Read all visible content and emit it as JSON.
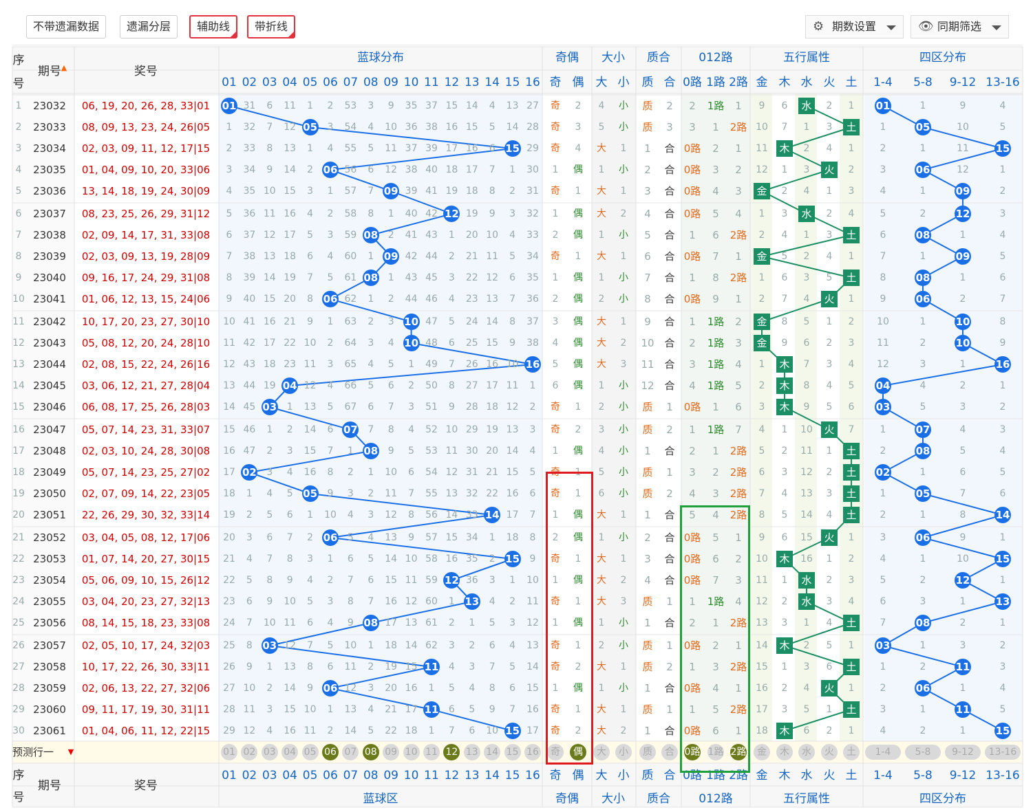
{
  "toolbar": {
    "buttons": [
      "不带遗漏数据",
      "遗漏分层",
      "辅助线",
      "带折线"
    ],
    "active": [
      false,
      false,
      true,
      true
    ],
    "period_setting": "期数设置",
    "same_filter": "同期筛选",
    "icons": [
      "gear-icon",
      "eye-icon"
    ]
  },
  "header": {
    "seq": "序号",
    "period": "期号",
    "draw": "奖号",
    "blue_dist": "蓝球分布",
    "odd_even": "奇偶",
    "big_small": "大小",
    "prime_comp": "质合",
    "route012": "012路",
    "five_elements": "五行属性",
    "four_zones": "四区分布",
    "blue_nums": [
      "01",
      "02",
      "03",
      "04",
      "05",
      "06",
      "07",
      "08",
      "09",
      "10",
      "11",
      "12",
      "13",
      "14",
      "15",
      "16"
    ],
    "oe": [
      "奇",
      "偶"
    ],
    "bs": [
      "大",
      "小"
    ],
    "pc": [
      "质",
      "合"
    ],
    "route": [
      "0路",
      "1路",
      "2路"
    ],
    "wx": [
      "金",
      "木",
      "水",
      "火",
      "土"
    ],
    "zones": [
      "1-4",
      "5-8",
      "9-12",
      "13-16"
    ]
  },
  "footer": {
    "seq": "序号",
    "period": "期号",
    "draw": "奖号",
    "blue_area": "蓝球区",
    "odd_even": "奇偶",
    "big_small": "大小",
    "prime_comp": "质合",
    "route012": "012路",
    "five_elements": "五行属性",
    "four_zones": "四区分布"
  },
  "predict": {
    "label": "预测行一",
    "hits": [
      "06",
      "08",
      "12"
    ],
    "hit_extra": [
      "偶",
      "0路",
      "2路"
    ]
  },
  "rows": [
    [
      "23032",
      "06, 19, 20, 26, 28, 33",
      "01",
      [
        0,
        31,
        6,
        11,
        1,
        2,
        53,
        3,
        9,
        35,
        37,
        15,
        14,
        4,
        13,
        27
      ],
      [
        "奇",
        "2"
      ],
      [
        "4",
        "小"
      ],
      [
        "质",
        "2"
      ],
      [
        "2",
        "1路",
        "1"
      ],
      [
        "9",
        "6",
        "水",
        "2",
        "1"
      ],
      [
        0,
        1,
        9,
        4
      ]
    ],
    [
      "23033",
      "08, 09, 13, 23, 24, 26",
      "05",
      [
        1,
        32,
        7,
        12,
        0,
        3,
        54,
        4,
        10,
        36,
        38,
        16,
        15,
        5,
        14,
        28
      ],
      [
        "奇",
        "3"
      ],
      [
        "5",
        "小"
      ],
      [
        "质",
        "3"
      ],
      [
        "3",
        "1",
        "2路"
      ],
      [
        "10",
        "7",
        "1",
        "3",
        "土"
      ],
      [
        1,
        0,
        10,
        5
      ]
    ],
    [
      "23034",
      "02, 03, 09, 11, 12, 17",
      "15",
      [
        2,
        33,
        8,
        13,
        1,
        4,
        55,
        5,
        11,
        37,
        39,
        17,
        16,
        6,
        0,
        29
      ],
      [
        "奇",
        "4"
      ],
      [
        "大",
        "1"
      ],
      [
        "1",
        "合"
      ],
      [
        "0路",
        "2",
        "1"
      ],
      [
        "11",
        "木",
        "2",
        "4",
        "1"
      ],
      [
        2,
        1,
        11,
        0
      ]
    ],
    [
      "23035",
      "01, 04, 09, 10, 20, 33",
      "06",
      [
        3,
        34,
        9,
        14,
        2,
        0,
        56,
        6,
        12,
        38,
        40,
        18,
        17,
        7,
        1,
        30
      ],
      [
        "1",
        "偶"
      ],
      [
        "1",
        "小"
      ],
      [
        "2",
        "合"
      ],
      [
        "0路",
        "3",
        "2"
      ],
      [
        "12",
        "1",
        "3",
        "火",
        "2"
      ],
      [
        3,
        0,
        12,
        1
      ]
    ],
    [
      "23036",
      "13, 14, 18, 19, 24, 30",
      "09",
      [
        4,
        35,
        10,
        15,
        3,
        1,
        57,
        7,
        0,
        39,
        41,
        19,
        18,
        8,
        2,
        31
      ],
      [
        "奇",
        "1"
      ],
      [
        "大",
        "1"
      ],
      [
        "3",
        "合"
      ],
      [
        "0路",
        "4",
        "3"
      ],
      [
        "金",
        "2",
        "4",
        "1",
        "3"
      ],
      [
        4,
        1,
        0,
        2
      ]
    ],
    [
      "23037",
      "08, 23, 25, 26, 29, 31",
      "12",
      [
        5,
        36,
        11,
        16,
        4,
        2,
        58,
        8,
        1,
        40,
        42,
        0,
        19,
        9,
        3,
        32
      ],
      [
        "1",
        "偶"
      ],
      [
        "大",
        "2"
      ],
      [
        "4",
        "合"
      ],
      [
        "0路",
        "5",
        "4"
      ],
      [
        "1",
        "3",
        "水",
        "2",
        "4"
      ],
      [
        5,
        2,
        0,
        3
      ]
    ],
    [
      "23038",
      "02, 09, 14, 17, 31, 33",
      "08",
      [
        6,
        37,
        12,
        17,
        5,
        3,
        59,
        0,
        2,
        41,
        43,
        1,
        20,
        10,
        4,
        33
      ],
      [
        "2",
        "偶"
      ],
      [
        "1",
        "小"
      ],
      [
        "5",
        "合"
      ],
      [
        "1",
        "6",
        "2路"
      ],
      [
        "2",
        "4",
        "1",
        "3",
        "土"
      ],
      [
        6,
        0,
        1,
        4
      ]
    ],
    [
      "23039",
      "02, 03, 09, 13, 19, 28",
      "09",
      [
        7,
        38,
        13,
        18,
        6,
        4,
        60,
        1,
        0,
        42,
        44,
        2,
        21,
        11,
        5,
        34
      ],
      [
        "奇",
        "1"
      ],
      [
        "大",
        "1"
      ],
      [
        "6",
        "合"
      ],
      [
        "0路",
        "7",
        "1"
      ],
      [
        "金",
        "5",
        "2",
        "4",
        "1"
      ],
      [
        7,
        1,
        0,
        5
      ]
    ],
    [
      "23040",
      "09, 16, 17, 24, 29, 31",
      "08",
      [
        8,
        39,
        14,
        19,
        7,
        5,
        61,
        0,
        1,
        43,
        45,
        3,
        22,
        12,
        6,
        35
      ],
      [
        "1",
        "偶"
      ],
      [
        "1",
        "小"
      ],
      [
        "7",
        "合"
      ],
      [
        "1",
        "8",
        "2路"
      ],
      [
        "1",
        "6",
        "3",
        "5",
        "土"
      ],
      [
        8,
        0,
        1,
        6
      ]
    ],
    [
      "23041",
      "01, 06, 12, 13, 15, 24",
      "06",
      [
        9,
        40,
        15,
        20,
        8,
        0,
        62,
        1,
        2,
        44,
        46,
        4,
        23,
        13,
        7,
        36
      ],
      [
        "2",
        "偶"
      ],
      [
        "2",
        "小"
      ],
      [
        "8",
        "合"
      ],
      [
        "0路",
        "9",
        "1"
      ],
      [
        "2",
        "7",
        "4",
        "火",
        "1"
      ],
      [
        9,
        0,
        2,
        7
      ]
    ],
    [
      "23042",
      "10, 17, 20, 23, 27, 30",
      "10",
      [
        10,
        41,
        16,
        21,
        9,
        1,
        63,
        2,
        3,
        0,
        47,
        5,
        24,
        14,
        8,
        37
      ],
      [
        "3",
        "偶"
      ],
      [
        "大",
        "1"
      ],
      [
        "9",
        "合"
      ],
      [
        "1",
        "1路",
        "2"
      ],
      [
        "金",
        "8",
        "5",
        "1",
        "2"
      ],
      [
        10,
        1,
        0,
        8
      ]
    ],
    [
      "23043",
      "05, 08, 12, 20, 24, 28",
      "10",
      [
        11,
        42,
        17,
        22,
        10,
        2,
        64,
        3,
        4,
        0,
        48,
        6,
        25,
        15,
        9,
        38
      ],
      [
        "4",
        "偶"
      ],
      [
        "大",
        "2"
      ],
      [
        "10",
        "合"
      ],
      [
        "2",
        "1路",
        "3"
      ],
      [
        "金",
        "9",
        "6",
        "2",
        "3"
      ],
      [
        11,
        2,
        0,
        9
      ]
    ],
    [
      "23044",
      "02, 08, 15, 22, 24, 26",
      "16",
      [
        12,
        43,
        18,
        23,
        11,
        3,
        65,
        4,
        5,
        1,
        49,
        7,
        26,
        16,
        10,
        0
      ],
      [
        "5",
        "偶"
      ],
      [
        "大",
        "3"
      ],
      [
        "11",
        "合"
      ],
      [
        "3",
        "1路",
        "4"
      ],
      [
        "1",
        "木",
        "7",
        "3",
        "4"
      ],
      [
        12,
        3,
        1,
        0
      ]
    ],
    [
      "23045",
      "03, 06, 12, 21, 27, 28",
      "04",
      [
        13,
        44,
        19,
        0,
        12,
        4,
        66,
        5,
        6,
        2,
        50,
        8,
        27,
        17,
        11,
        1
      ],
      [
        "6",
        "偶"
      ],
      [
        "1",
        "小"
      ],
      [
        "12",
        "合"
      ],
      [
        "4",
        "1路",
        "5"
      ],
      [
        "2",
        "木",
        "8",
        "4",
        "5"
      ],
      [
        0,
        4,
        2,
        1
      ]
    ],
    [
      "23046",
      "06, 08, 17, 25, 26, 28",
      "03",
      [
        14,
        45,
        0,
        1,
        13,
        5,
        67,
        6,
        7,
        3,
        51,
        9,
        28,
        18,
        12,
        2
      ],
      [
        "奇",
        "1"
      ],
      [
        "2",
        "小"
      ],
      [
        "质",
        "1"
      ],
      [
        "0路",
        "1",
        "6"
      ],
      [
        "3",
        "木",
        "9",
        "5",
        "6"
      ],
      [
        0,
        5,
        3,
        2
      ]
    ],
    [
      "23047",
      "05, 07, 14, 23, 31, 33",
      "07",
      [
        15,
        46,
        1,
        2,
        14,
        6,
        0,
        7,
        8,
        4,
        52,
        10,
        29,
        19,
        13,
        3
      ],
      [
        "奇",
        "2"
      ],
      [
        "3",
        "小"
      ],
      [
        "质",
        "2"
      ],
      [
        "1",
        "1路",
        "7"
      ],
      [
        "4",
        "1",
        "10",
        "火",
        "7"
      ],
      [
        1,
        0,
        4,
        3
      ]
    ],
    [
      "23048",
      "02, 03, 10, 24, 28, 30",
      "08",
      [
        16,
        47,
        2,
        3,
        15,
        7,
        1,
        0,
        9,
        5,
        53,
        11,
        30,
        20,
        14,
        4
      ],
      [
        "1",
        "偶"
      ],
      [
        "4",
        "小"
      ],
      [
        "1",
        "合"
      ],
      [
        "2",
        "1",
        "2路"
      ],
      [
        "5",
        "2",
        "11",
        "1",
        "土"
      ],
      [
        2,
        0,
        5,
        4
      ]
    ],
    [
      "23049",
      "05, 07, 14, 23, 25, 27",
      "02",
      [
        17,
        0,
        3,
        4,
        16,
        8,
        2,
        1,
        10,
        6,
        54,
        12,
        31,
        21,
        15,
        5
      ],
      [
        "奇",
        "1"
      ],
      [
        "5",
        "小"
      ],
      [
        "质",
        "1"
      ],
      [
        "3",
        "2",
        "2路"
      ],
      [
        "6",
        "3",
        "12",
        "2",
        "土"
      ],
      [
        0,
        1,
        6,
        5
      ]
    ],
    [
      "23050",
      "02, 07, 09, 14, 22, 23",
      "05",
      [
        18,
        1,
        4,
        5,
        0,
        9,
        3,
        2,
        11,
        7,
        55,
        13,
        32,
        22,
        16,
        6
      ],
      [
        "奇",
        "1"
      ],
      [
        "6",
        "小"
      ],
      [
        "质",
        "2"
      ],
      [
        "4",
        "3",
        "2路"
      ],
      [
        "7",
        "4",
        "13",
        "3",
        "土"
      ],
      [
        1,
        0,
        7,
        6
      ]
    ],
    [
      "23051",
      "22, 26, 29, 30, 32, 33",
      "14",
      [
        19,
        2,
        5,
        6,
        1,
        10,
        4,
        3,
        12,
        8,
        56,
        14,
        33,
        0,
        17,
        7
      ],
      [
        "1",
        "偶"
      ],
      [
        "大",
        "1"
      ],
      [
        "1",
        "合"
      ],
      [
        "5",
        "4",
        "2路"
      ],
      [
        "8",
        "5",
        "14",
        "4",
        "土"
      ],
      [
        2,
        1,
        8,
        0
      ]
    ],
    [
      "23052",
      "03, 04, 05, 08, 12, 17",
      "06",
      [
        20,
        3,
        6,
        7,
        2,
        0,
        5,
        4,
        13,
        9,
        57,
        15,
        34,
        1,
        18,
        8
      ],
      [
        "2",
        "偶"
      ],
      [
        "1",
        "小"
      ],
      [
        "2",
        "合"
      ],
      [
        "0路",
        "5",
        "1"
      ],
      [
        "9",
        "6",
        "15",
        "火",
        "1"
      ],
      [
        3,
        0,
        9,
        1
      ]
    ],
    [
      "23053",
      "01, 07, 14, 20, 27, 30",
      "15",
      [
        21,
        4,
        7,
        8,
        3,
        1,
        6,
        5,
        14,
        10,
        58,
        16,
        35,
        2,
        0,
        9
      ],
      [
        "奇",
        "1"
      ],
      [
        "大",
        "1"
      ],
      [
        "3",
        "合"
      ],
      [
        "0路",
        "6",
        "2"
      ],
      [
        "10",
        "木",
        "16",
        "1",
        "2"
      ],
      [
        4,
        1,
        10,
        0
      ]
    ],
    [
      "23054",
      "05, 06, 09, 10, 15, 26",
      "12",
      [
        22,
        5,
        8,
        9,
        4,
        2,
        7,
        6,
        15,
        11,
        59,
        0,
        36,
        3,
        1,
        10
      ],
      [
        "1",
        "偶"
      ],
      [
        "大",
        "2"
      ],
      [
        "4",
        "合"
      ],
      [
        "0路",
        "7",
        "3"
      ],
      [
        "11",
        "1",
        "水",
        "2",
        "3"
      ],
      [
        5,
        2,
        0,
        1
      ]
    ],
    [
      "23055",
      "03, 04, 20, 23, 27, 32",
      "13",
      [
        23,
        6,
        9,
        10,
        5,
        3,
        8,
        7,
        16,
        12,
        60,
        1,
        0,
        4,
        2,
        11
      ],
      [
        "奇",
        "1"
      ],
      [
        "大",
        "3"
      ],
      [
        "质",
        "1"
      ],
      [
        "1",
        "1路",
        "4"
      ],
      [
        "12",
        "2",
        "水",
        "3",
        "4"
      ],
      [
        6,
        3,
        1,
        0
      ]
    ],
    [
      "23056",
      "08, 14, 15, 18, 23, 33",
      "08",
      [
        24,
        7,
        10,
        11,
        6,
        4,
        9,
        0,
        17,
        13,
        61,
        2,
        1,
        5,
        3,
        12
      ],
      [
        "1",
        "偶"
      ],
      [
        "1",
        "小"
      ],
      [
        "1",
        "合"
      ],
      [
        "2",
        "1",
        "2路"
      ],
      [
        "13",
        "3",
        "1",
        "4",
        "土"
      ],
      [
        7,
        0,
        2,
        1
      ]
    ],
    [
      "23057",
      "02, 05, 10, 17, 24, 32",
      "03",
      [
        25,
        8,
        0,
        12,
        7,
        5,
        10,
        1,
        18,
        14,
        62,
        3,
        2,
        6,
        4,
        13
      ],
      [
        "奇",
        "1"
      ],
      [
        "2",
        "小"
      ],
      [
        "质",
        "1"
      ],
      [
        "0路",
        "2",
        "1"
      ],
      [
        "14",
        "木",
        "2",
        "5",
        "1"
      ],
      [
        0,
        1,
        3,
        2
      ]
    ],
    [
      "23058",
      "10, 17, 22, 26, 30, 33",
      "11",
      [
        26,
        9,
        1,
        13,
        8,
        6,
        11,
        2,
        19,
        15,
        0,
        4,
        3,
        7,
        5,
        14
      ],
      [
        "奇",
        "2"
      ],
      [
        "大",
        "1"
      ],
      [
        "质",
        "2"
      ],
      [
        "1",
        "3",
        "2路"
      ],
      [
        "15",
        "1",
        "3",
        "6",
        "土"
      ],
      [
        1,
        2,
        0,
        3
      ]
    ],
    [
      "23059",
      "02, 06, 13, 22, 27, 32",
      "06",
      [
        27,
        10,
        2,
        14,
        9,
        0,
        12,
        3,
        20,
        16,
        1,
        5,
        4,
        8,
        6,
        15
      ],
      [
        "1",
        "偶"
      ],
      [
        "1",
        "小"
      ],
      [
        "1",
        "合"
      ],
      [
        "0路",
        "4",
        "1"
      ],
      [
        "16",
        "2",
        "4",
        "火",
        "1"
      ],
      [
        2,
        0,
        1,
        4
      ]
    ],
    [
      "23060",
      "09, 11, 17, 19, 30, 31",
      "11",
      [
        28,
        11,
        3,
        15,
        10,
        1,
        13,
        4,
        21,
        17,
        0,
        6,
        5,
        9,
        7,
        16
      ],
      [
        "奇",
        "1"
      ],
      [
        "大",
        "1"
      ],
      [
        "质",
        "1"
      ],
      [
        "1",
        "5",
        "2路"
      ],
      [
        "17",
        "3",
        "5",
        "1",
        "土"
      ],
      [
        3,
        1,
        0,
        5
      ]
    ],
    [
      "23061",
      "01, 04, 06, 11, 12, 22",
      "15",
      [
        29,
        12,
        4,
        16,
        11,
        2,
        14,
        5,
        22,
        18,
        1,
        7,
        6,
        10,
        0,
        17
      ],
      [
        "奇",
        "2"
      ],
      [
        "大",
        "2"
      ],
      [
        "1",
        "合"
      ],
      [
        "0路",
        "6",
        "1"
      ],
      [
        "18",
        "木",
        "6",
        "2",
        "1"
      ],
      [
        4,
        2,
        1,
        0
      ]
    ]
  ]
}
